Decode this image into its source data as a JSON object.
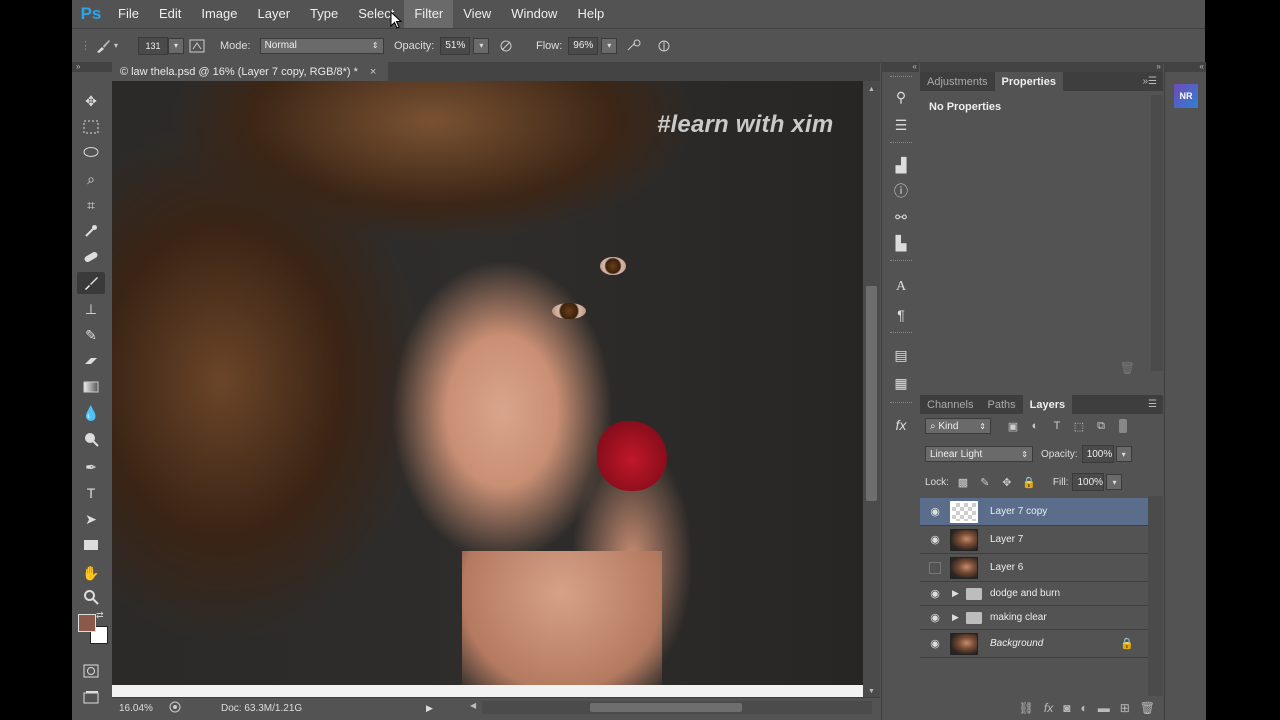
{
  "app": {
    "logo": "Ps"
  },
  "menu": [
    "File",
    "Edit",
    "Image",
    "Layer",
    "Type",
    "Select",
    "Filter",
    "View",
    "Window",
    "Help"
  ],
  "options": {
    "brush_size": "131",
    "mode_label": "Mode:",
    "mode_value": "Normal",
    "opacity_label": "Opacity:",
    "opacity_value": "51%",
    "flow_label": "Flow:",
    "flow_value": "96%"
  },
  "document": {
    "tab_title": "law thela.psd @ 16% (Layer 7 copy, RGB/8*) *",
    "watermark": "#learn with xim"
  },
  "status": {
    "zoom": "16.04%",
    "doc_info": "Doc: 63.3M/1.21G"
  },
  "properties_panel": {
    "tabs": [
      "Adjustments",
      "Properties"
    ],
    "active_tab": "Properties",
    "message": "No Properties"
  },
  "layers_panel": {
    "tabs": [
      "Channels",
      "Paths",
      "Layers"
    ],
    "active_tab": "Layers",
    "filter_kind": "Kind",
    "blend_mode": "Linear Light",
    "opacity_label": "Opacity:",
    "opacity_value": "100%",
    "lock_label": "Lock:",
    "fill_label": "Fill:",
    "fill_value": "100%",
    "layers": [
      {
        "name": "Layer 7 copy",
        "visible": true,
        "selected": true,
        "type": "layer"
      },
      {
        "name": "Layer 7",
        "visible": true,
        "selected": false,
        "type": "layer"
      },
      {
        "name": "Layer 6",
        "visible": false,
        "selected": false,
        "type": "layer"
      },
      {
        "name": "dodge and burn",
        "visible": true,
        "selected": false,
        "type": "group"
      },
      {
        "name": "making clear",
        "visible": true,
        "selected": false,
        "type": "group"
      },
      {
        "name": "Background",
        "visible": true,
        "selected": false,
        "type": "background",
        "locked": true
      }
    ]
  },
  "plugin_icon": "NR",
  "colors": {
    "foreground": "#8a5a48",
    "background": "#ffffff",
    "selected_layer": "#5a6e8c",
    "ui_panel": "#535353"
  }
}
